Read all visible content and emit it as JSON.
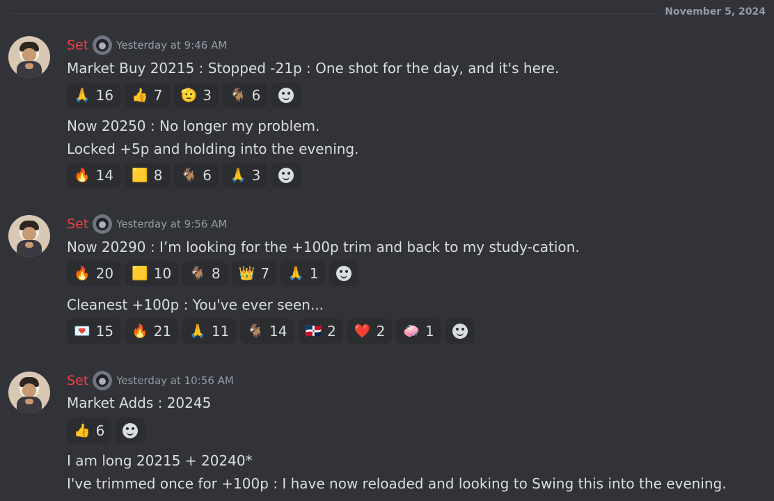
{
  "date_divider": "November 5, 2024",
  "messages": [
    {
      "author": "Set",
      "timestamp": "Yesterday at 9:46 AM",
      "blocks": [
        {
          "lines": [
            "Market Buy 20215 : Stopped -21p : One shot for the day, and it's here."
          ],
          "reactions": [
            {
              "emoji": "🙏",
              "count": "16"
            },
            {
              "emoji": "👍",
              "count": "7"
            },
            {
              "emoji": "🫡",
              "count": "3"
            },
            {
              "emoji": "🐐",
              "count": "6"
            }
          ]
        },
        {
          "lines": [
            "Now 20250 : No longer my problem.",
            "Locked +5p and holding into the evening."
          ],
          "reactions": [
            {
              "emoji": "🔥",
              "count": "14"
            },
            {
              "emoji": "🟨",
              "count": "8"
            },
            {
              "emoji": "🐐",
              "count": "6"
            },
            {
              "emoji": "🙏",
              "count": "3"
            }
          ]
        }
      ]
    },
    {
      "author": "Set",
      "timestamp": "Yesterday at 9:56 AM",
      "blocks": [
        {
          "lines": [
            "Now 20290 : I’m looking for the +100p trim and back to my study-cation."
          ],
          "reactions": [
            {
              "emoji": "🔥",
              "count": "20"
            },
            {
              "emoji": "🟨",
              "count": "10"
            },
            {
              "emoji": "🐐",
              "count": "8"
            },
            {
              "emoji": "👑",
              "count": "7"
            },
            {
              "emoji": "🙏",
              "count": "1"
            }
          ]
        },
        {
          "lines": [
            "Cleanest +100p : You've ever seen..."
          ],
          "reactions": [
            {
              "emoji": "💌",
              "count": "15"
            },
            {
              "emoji": "🔥",
              "count": "21"
            },
            {
              "emoji": "🙏",
              "count": "11"
            },
            {
              "emoji": "🐐",
              "count": "14"
            },
            {
              "emoji": "🇩🇴",
              "count": "2"
            },
            {
              "emoji": "❤️",
              "count": "2"
            },
            {
              "emoji": "🧼",
              "count": "1"
            }
          ]
        }
      ]
    },
    {
      "author": "Set",
      "timestamp": "Yesterday at 10:56 AM",
      "blocks": [
        {
          "lines": [
            "Market Adds : 20245"
          ],
          "reactions": [
            {
              "emoji": "👍",
              "count": "6"
            }
          ]
        },
        {
          "lines": [
            "I am long 20215 + 20240*",
            "I've trimmed once for +100p : I have now reloaded and looking to Swing this into the evening."
          ],
          "reactions": []
        }
      ]
    }
  ]
}
